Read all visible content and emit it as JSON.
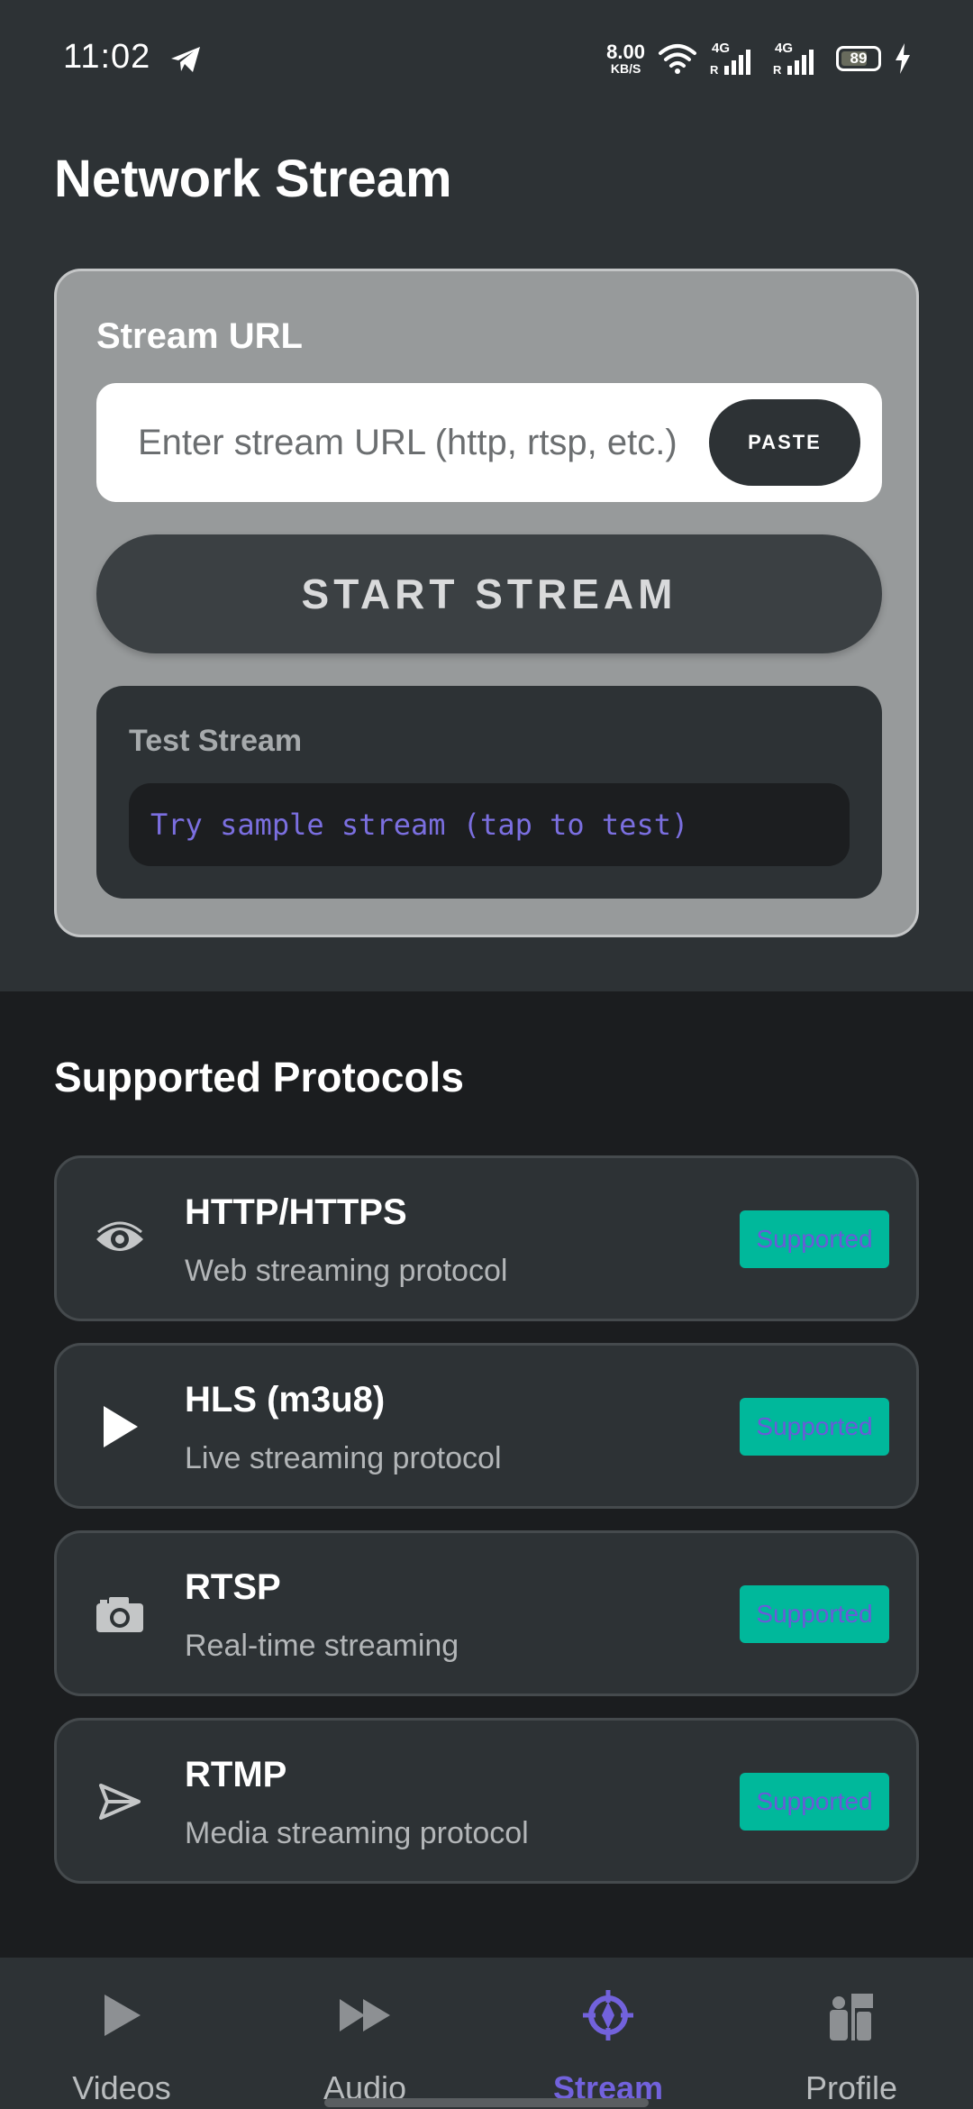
{
  "status_bar": {
    "time": "11:02",
    "net_speed_value": "8.00",
    "net_speed_unit": "KB/S",
    "signal1_label": "4G",
    "signal1_sub": "R",
    "signal2_label": "4G",
    "signal2_sub": "R",
    "battery": "89",
    "icons": [
      "telegram-icon",
      "wifi-icon",
      "signal-icon",
      "signal-icon",
      "battery-icon",
      "charging-icon"
    ]
  },
  "page": {
    "title": "Network Stream"
  },
  "stream_url": {
    "title": "Stream URL",
    "input_value": "",
    "input_placeholder": "Enter stream URL (http, rtsp, etc.)",
    "paste_label": "PASTE",
    "start_label": "START STREAM"
  },
  "test_stream": {
    "title": "Test Stream",
    "sample_label": "Try sample stream (tap to test)"
  },
  "protocols": {
    "title": "Supported Protocols",
    "items": [
      {
        "name": "HTTP/HTTPS",
        "description": "Web streaming protocol",
        "badge": "Supported",
        "icon": "eye-icon"
      },
      {
        "name": "HLS (m3u8)",
        "description": "Live streaming protocol",
        "badge": "Supported",
        "icon": "play-icon"
      },
      {
        "name": "RTSP",
        "description": "Real-time streaming",
        "badge": "Supported",
        "icon": "camera-icon"
      },
      {
        "name": "RTMP",
        "description": "Media streaming protocol",
        "badge": "Supported",
        "icon": "send-icon"
      }
    ]
  },
  "bottom_nav": {
    "items": [
      {
        "label": "Videos",
        "icon": "play-icon",
        "active": false
      },
      {
        "label": "Audio",
        "icon": "fast-forward-icon",
        "active": false
      },
      {
        "label": "Stream",
        "icon": "compass-icon",
        "active": true
      },
      {
        "label": "Profile",
        "icon": "people-icon",
        "active": false
      }
    ]
  },
  "colors": {
    "background": "#1b1d1f",
    "header_background": "#2d3235",
    "card_background": "#979a9b",
    "accent": "#7262dc",
    "badge": "#00b89b"
  }
}
